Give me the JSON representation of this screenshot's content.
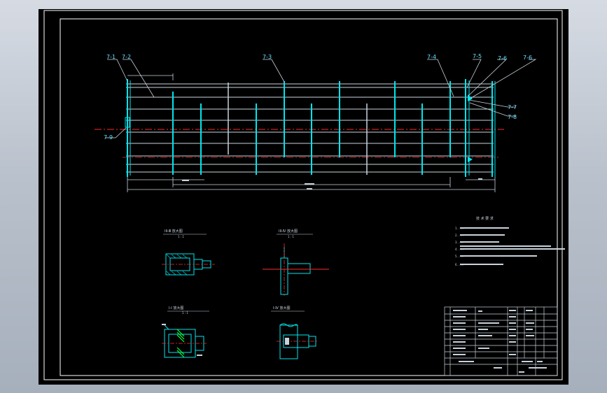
{
  "drawing": {
    "background": "#000000",
    "frame_color": "#ffffff",
    "geometry_color": "#00e5ee",
    "centerline_color": "#ff2a2a",
    "label_color": "#66e0ff",
    "accent_color": "#00ff3a",
    "callouts": {
      "c1": "7-1",
      "c2": "7-2",
      "c3": "7-3",
      "c4": "7-4",
      "c5": "7-5",
      "c6": "7-6",
      "c7": "7-6",
      "c8": "7-7",
      "c9": "7-8",
      "c10": "7-9"
    },
    "section_views": {
      "v1": {
        "title": "ⅠⅡ-Ⅲ  放大图",
        "sub": "1 : 1"
      },
      "v2": {
        "title": "ⅠⅡ-Ⅳ  放大图",
        "sub": "1 : 1"
      },
      "v3": {
        "title": "Ⅰ-Ⅰ  放大图",
        "sub": "1 : 1"
      },
      "v4": {
        "title": "Ⅰ-Ⅳ  放大图",
        "sub": ""
      }
    },
    "notes": {
      "title": "技 术 要 求",
      "lines": [
        "1. ......",
        "2. ......",
        "3. ......",
        "4. ......",
        "5. ......",
        "6. ......"
      ]
    },
    "title_block": {
      "rows": 10
    }
  }
}
